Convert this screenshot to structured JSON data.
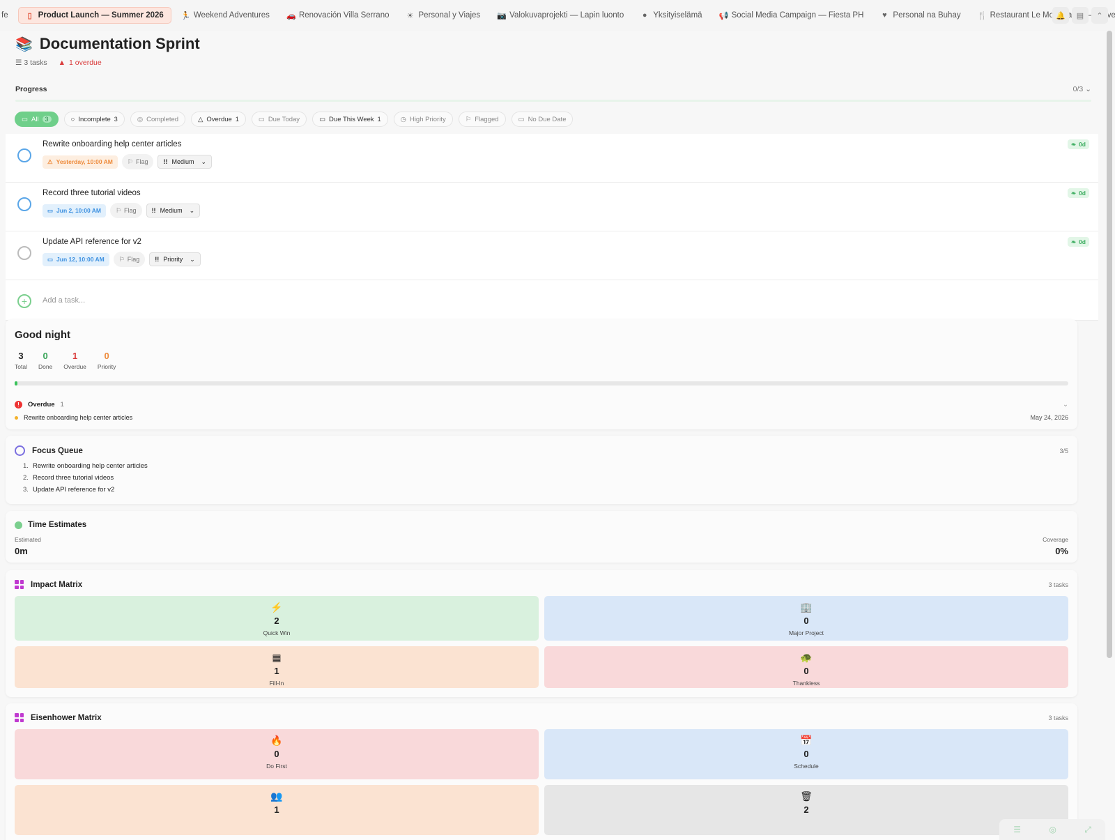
{
  "tabs": [
    {
      "label": "fe",
      "icon": ""
    },
    {
      "label": "Product Launch — Summer 2026",
      "icon": "▯",
      "active": true
    },
    {
      "label": "Weekend Adventures",
      "icon": "🏃"
    },
    {
      "label": "Renovación Villa Serrano",
      "icon": "🚗"
    },
    {
      "label": "Personal y Viajes",
      "icon": "☀"
    },
    {
      "label": "Valokuvaprojekti — Lapin luonto",
      "icon": "📷"
    },
    {
      "label": "Yksityiselämä",
      "icon": "●"
    },
    {
      "label": "Social Media Campaign — Fiesta PH",
      "icon": "📢"
    },
    {
      "label": "Personal na Buhay",
      "icon": "♥"
    },
    {
      "label": "Restaurant Le Montréalais — Ouverture",
      "icon": "🍴"
    }
  ],
  "tabbar_icons": [
    "bell-icon",
    "panel-icon",
    "chevron-up-icon"
  ],
  "header": {
    "emoji": "📚",
    "title": "Documentation Sprint",
    "task_count": "3 tasks",
    "overdue": "1 overdue"
  },
  "progress": {
    "label": "Progress",
    "count": "0/3",
    "fraction": 0
  },
  "filters": [
    {
      "label": "All",
      "badge": "3",
      "style": "all"
    },
    {
      "label": "Incomplete",
      "badge": "3",
      "style": "normal"
    },
    {
      "label": "Completed",
      "badge": "",
      "style": "muted"
    },
    {
      "label": "Overdue",
      "badge": "1",
      "style": "normal"
    },
    {
      "label": "Due Today",
      "badge": "",
      "style": "muted"
    },
    {
      "label": "Due This Week",
      "badge": "1",
      "style": "normal"
    },
    {
      "label": "High Priority",
      "badge": "",
      "style": "muted"
    },
    {
      "label": "Flagged",
      "badge": "",
      "style": "muted"
    },
    {
      "label": "No Due Date",
      "badge": "",
      "style": "muted"
    }
  ],
  "tasks": [
    {
      "name": "Rewrite onboarding help center articles",
      "date": "Yesterday, 10:00 AM",
      "date_state": "late",
      "flag": "Flag",
      "priority": "Medium",
      "badge": "0d",
      "check": "blue"
    },
    {
      "name": "Record three tutorial videos",
      "date": "Jun 2, 10:00 AM",
      "date_state": "soon",
      "flag": "Flag",
      "priority": "Medium",
      "badge": "0d",
      "check": "blue"
    },
    {
      "name": "Update API reference for v2",
      "date": "Jun 12, 10:00 AM",
      "date_state": "soon",
      "flag": "Flag",
      "priority": "Priority",
      "badge": "0d",
      "check": "grey"
    }
  ],
  "add_task_placeholder": "Add a task...",
  "summary": {
    "greeting": "Good night",
    "stats": [
      {
        "value": "3",
        "label": "Total",
        "color": "#222222"
      },
      {
        "value": "0",
        "label": "Done",
        "color": "#3aa55a"
      },
      {
        "value": "1",
        "label": "Overdue",
        "color": "#d93a3a"
      },
      {
        "value": "0",
        "label": "Priority",
        "color": "#ee8a3a"
      }
    ],
    "done_fraction": 0.0,
    "overdue_label": "Overdue",
    "overdue_count": "1",
    "overdue_item": "Rewrite onboarding help center articles",
    "overdue_date": "May 24, 2026"
  },
  "focus_queue": {
    "title": "Focus Queue",
    "count": "3/5",
    "items": [
      "Rewrite onboarding help center articles",
      "Record three tutorial videos",
      "Update API reference for v2"
    ]
  },
  "time_estimates": {
    "title": "Time Estimates",
    "estimated_label": "Estimated",
    "estimated_value": "0m",
    "coverage_label": "Coverage",
    "coverage_value": "0%"
  },
  "impact_matrix": {
    "title": "Impact Matrix",
    "count": "3 tasks",
    "quadrants": [
      {
        "icon": "⚡",
        "value": "2",
        "label": "Quick Win",
        "style": "q-green"
      },
      {
        "icon": "🏢",
        "value": "0",
        "label": "Major Project",
        "style": "q-blue"
      },
      {
        "icon": "▦",
        "value": "1",
        "label": "Fill-In",
        "style": "q-orange"
      },
      {
        "icon": "🐢",
        "value": "0",
        "label": "Thankless",
        "style": "q-red"
      }
    ]
  },
  "eisenhower_matrix": {
    "title": "Eisenhower Matrix",
    "count": "3 tasks",
    "quadrants": [
      {
        "icon": "🔥",
        "value": "0",
        "label": "Do First",
        "style": "q-red"
      },
      {
        "icon": "📅",
        "value": "0",
        "label": "Schedule",
        "style": "q-blue"
      },
      {
        "icon": "👥",
        "value": "1",
        "label": "",
        "style": "q-orange"
      },
      {
        "icon": "🗑",
        "value": "2",
        "label": "",
        "style": "q-grey"
      }
    ]
  }
}
